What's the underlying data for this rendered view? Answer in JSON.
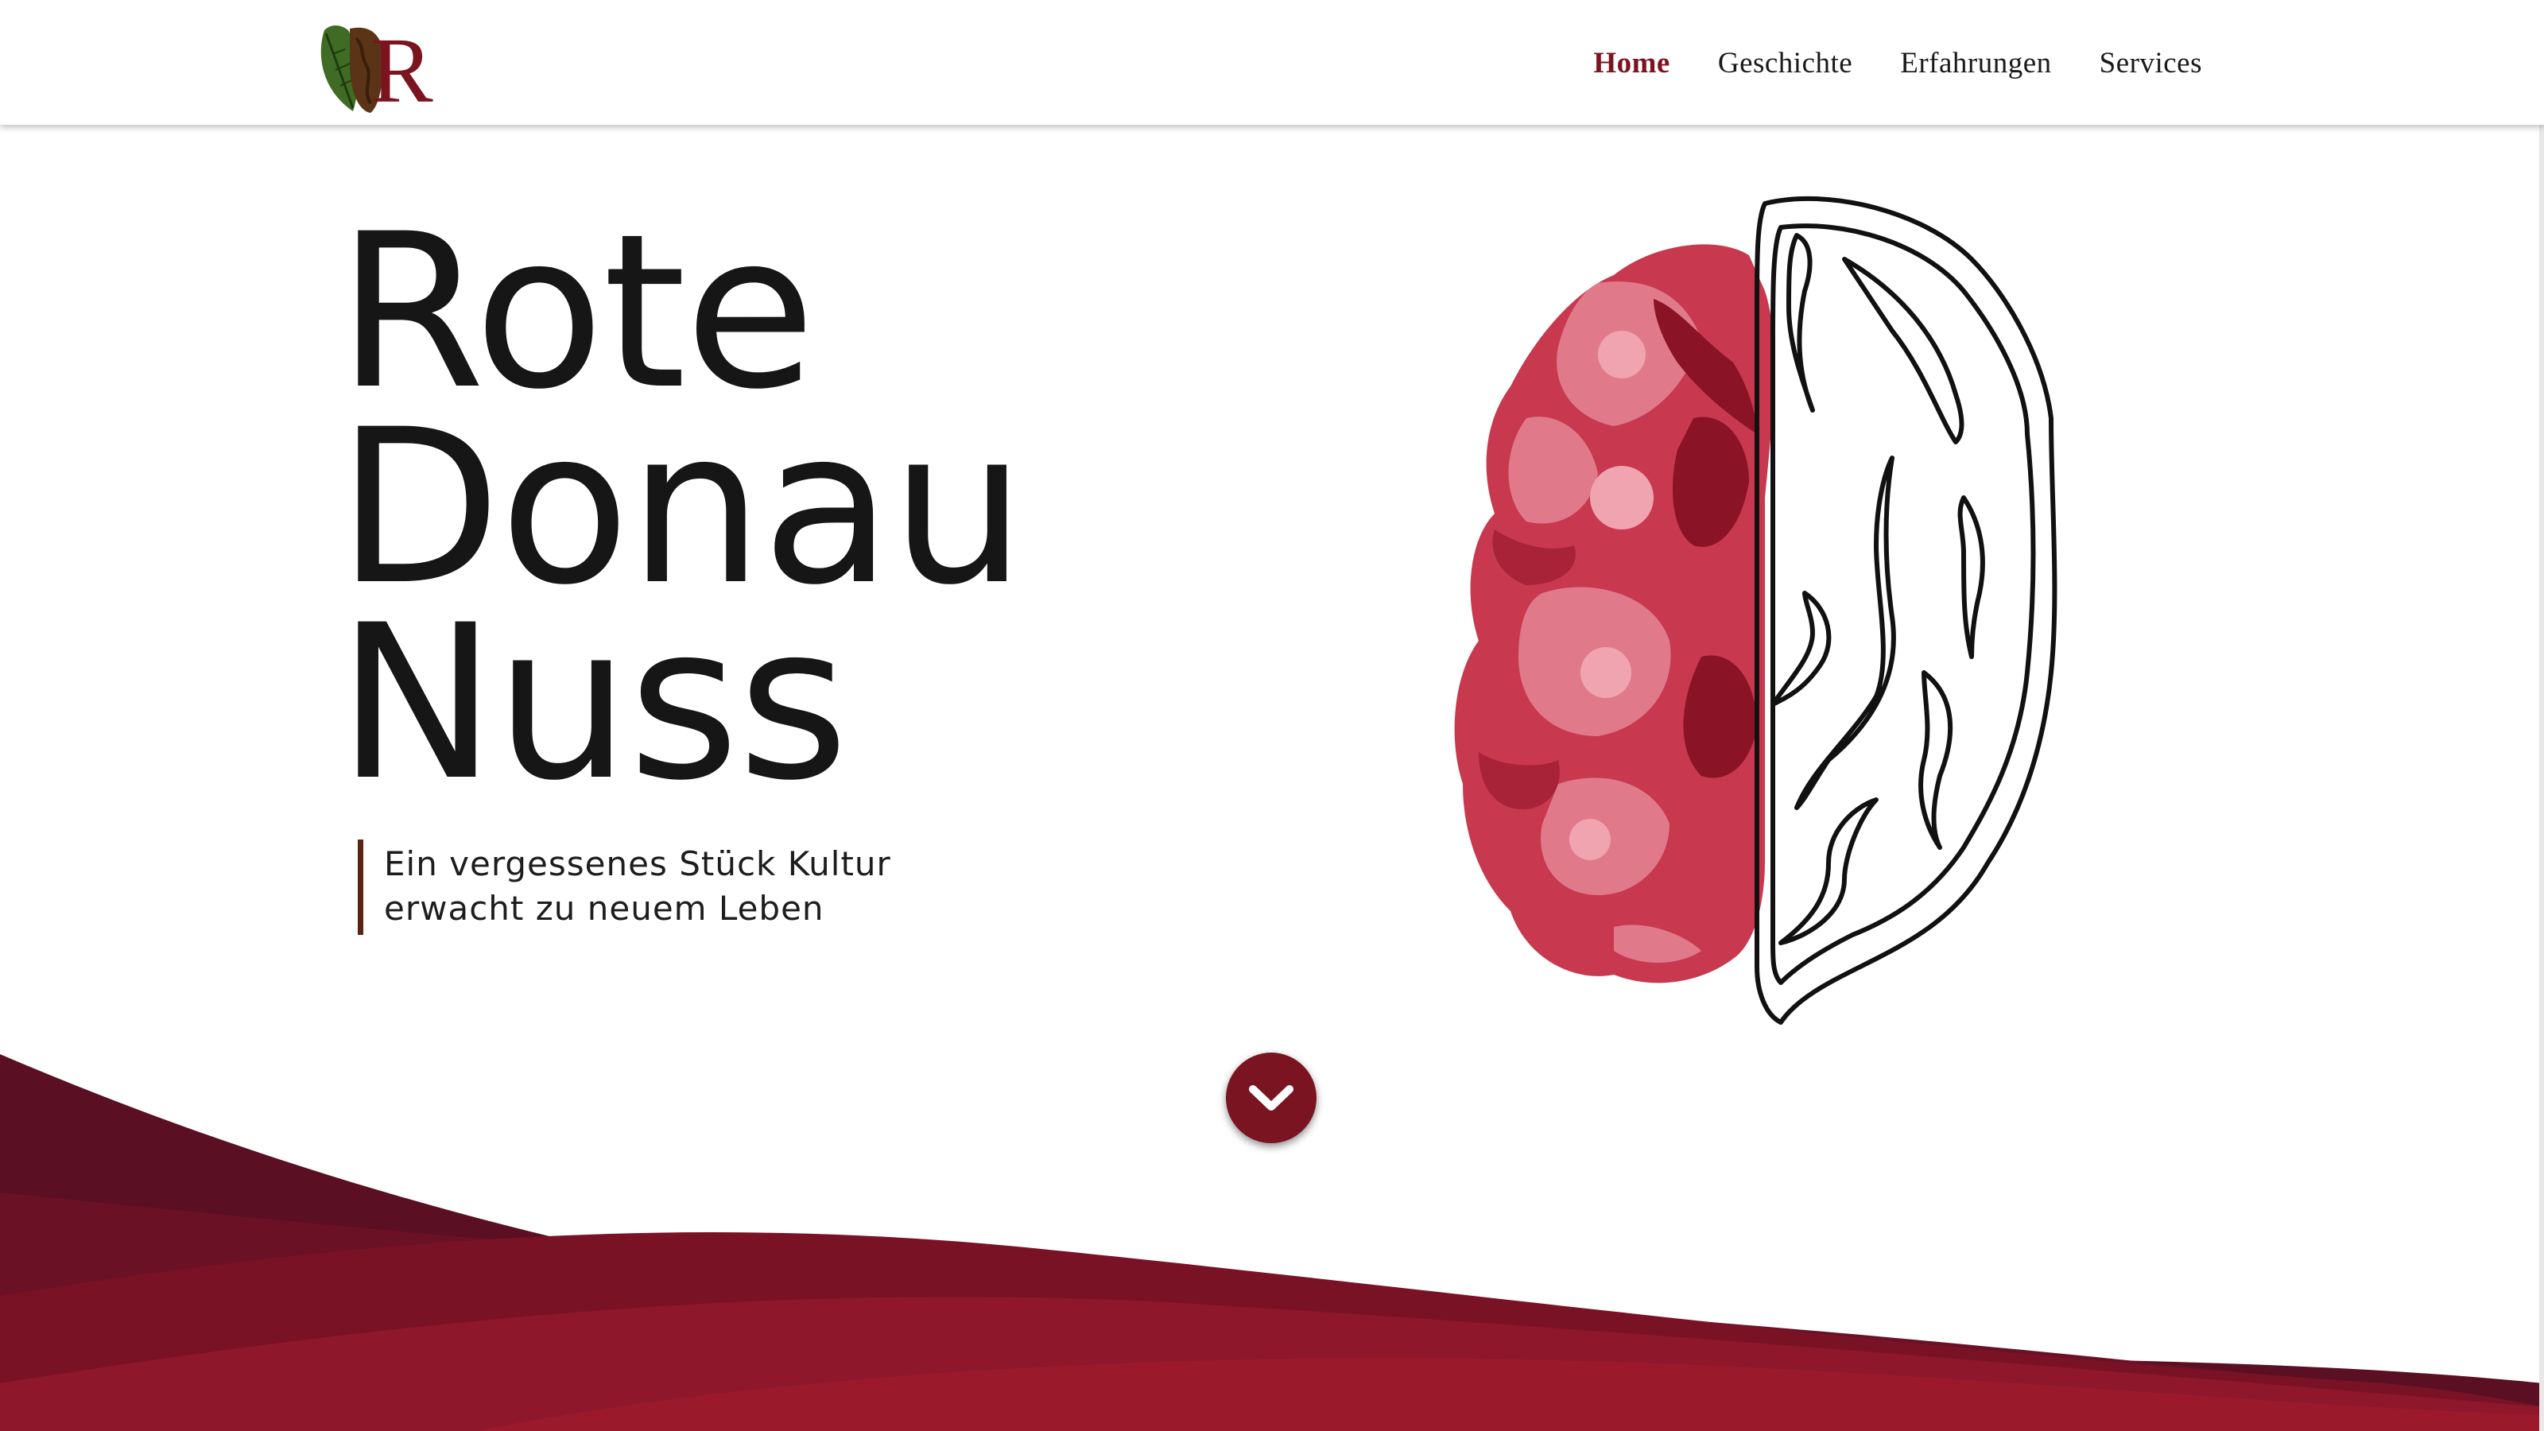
{
  "header": {
    "logo_letter": "R",
    "nav": [
      {
        "label": "Home",
        "active": true
      },
      {
        "label": "Geschichte",
        "active": false
      },
      {
        "label": "Erfahrungen",
        "active": false
      },
      {
        "label": "Services",
        "active": false
      }
    ]
  },
  "hero": {
    "title_lines": [
      "Rote",
      "Donau",
      "Nuss"
    ],
    "subtitle_line1": "Ein vergessenes Stück Kultur",
    "subtitle_line2": "erwacht zu neuem Leben"
  },
  "scroll_button": {
    "icon": "chevron-down-icon"
  },
  "colors": {
    "accent": "#7c1420",
    "wave_dark": "#5a0f22",
    "wave_mid": "#7a1226",
    "wave_bright": "#9a1a2c",
    "nut_light": "#e07a8a",
    "nut_mid": "#c8384f",
    "nut_dark": "#8a1425"
  }
}
